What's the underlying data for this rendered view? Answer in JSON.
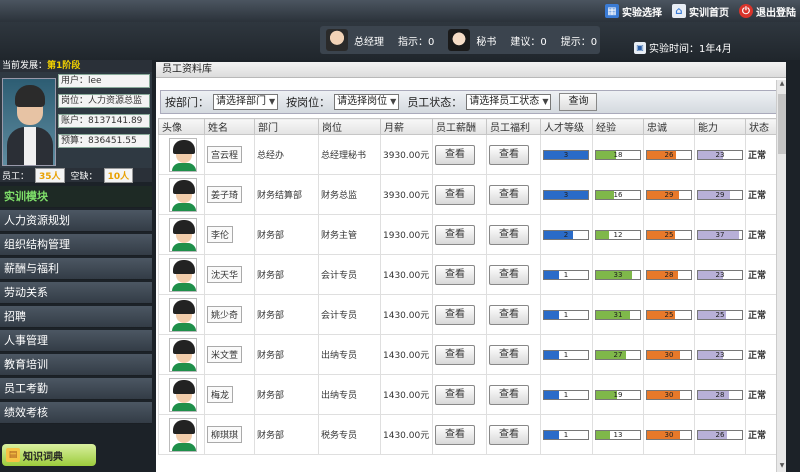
{
  "topnav": {
    "exp_select": "实验选择",
    "home": "实训首页",
    "logout": "退出登陆"
  },
  "roles": {
    "gm_label": "总经理",
    "instruct_label": "指示：0",
    "secretary_label": "秘书",
    "suggest_label": "建议：0",
    "hint_label": "提示：0"
  },
  "exp_time": "实验时间：1年4月",
  "sidebar": {
    "phase_label": "当前发展：",
    "phase_value": "第1阶段",
    "user": "用户：lee",
    "position": "岗位：人力资源总监",
    "account": "账户：8137141.89",
    "budget": "预算：836451.55",
    "staff_label": "员工：",
    "staff_value": "35人",
    "shortage_label": "空缺：",
    "shortage_value": "10人",
    "menu": [
      "实训模块",
      "人力资源规划",
      "组织结构管理",
      "薪酬与福利",
      "劳动关系",
      "招聘",
      "人事管理",
      "教育培训",
      "员工考勤",
      "绩效考核"
    ],
    "knowledge_btn": "知识词典"
  },
  "main": {
    "title": "员工资料库",
    "filter": {
      "dept_label": "按部门：",
      "dept_value": "请选择部门",
      "post_label": "按岗位：",
      "post_value": "请选择岗位",
      "status_label": "员工状态：",
      "status_value": "请选择员工状态",
      "query_btn": "查询"
    },
    "columns": [
      "头像",
      "姓名",
      "部门",
      "岗位",
      "月薪",
      "员工薪酬",
      "员工福利",
      "人才等级",
      "经验",
      "忠诚",
      "能力",
      "状态"
    ],
    "view_label": "查看",
    "rows": [
      {
        "name": "宫云程",
        "dept": "总经办",
        "post": "总经理秘书",
        "salary": "3930.00元",
        "level": 3,
        "exp": 18,
        "loyal": 26,
        "ability": 23,
        "status": "正常"
      },
      {
        "name": "姜子琦",
        "dept": "财务结算部",
        "post": "财务总监",
        "salary": "3930.00元",
        "level": 3,
        "exp": 16,
        "loyal": 29,
        "ability": 29,
        "status": "正常"
      },
      {
        "name": "李伦",
        "dept": "财务部",
        "post": "财务主管",
        "salary": "1930.00元",
        "level": 2,
        "exp": 12,
        "loyal": 25,
        "ability": 37,
        "status": "正常"
      },
      {
        "name": "沈天华",
        "dept": "财务部",
        "post": "会计专员",
        "salary": "1430.00元",
        "level": 1,
        "exp": 33,
        "loyal": 28,
        "ability": 23,
        "status": "正常"
      },
      {
        "name": "姚少奇",
        "dept": "财务部",
        "post": "会计专员",
        "salary": "1430.00元",
        "level": 1,
        "exp": 31,
        "loyal": 25,
        "ability": 25,
        "status": "正常"
      },
      {
        "name": "米文萱",
        "dept": "财务部",
        "post": "出纳专员",
        "salary": "1430.00元",
        "level": 1,
        "exp": 27,
        "loyal": 30,
        "ability": 23,
        "status": "正常"
      },
      {
        "name": "梅龙",
        "dept": "财务部",
        "post": "出纳专员",
        "salary": "1430.00元",
        "level": 1,
        "exp": 19,
        "loyal": 30,
        "ability": 28,
        "status": "正常"
      },
      {
        "name": "柳琪琪",
        "dept": "财务部",
        "post": "税务专员",
        "salary": "1430.00元",
        "level": 1,
        "exp": 13,
        "loyal": 30,
        "ability": 26,
        "status": "正常"
      }
    ]
  }
}
